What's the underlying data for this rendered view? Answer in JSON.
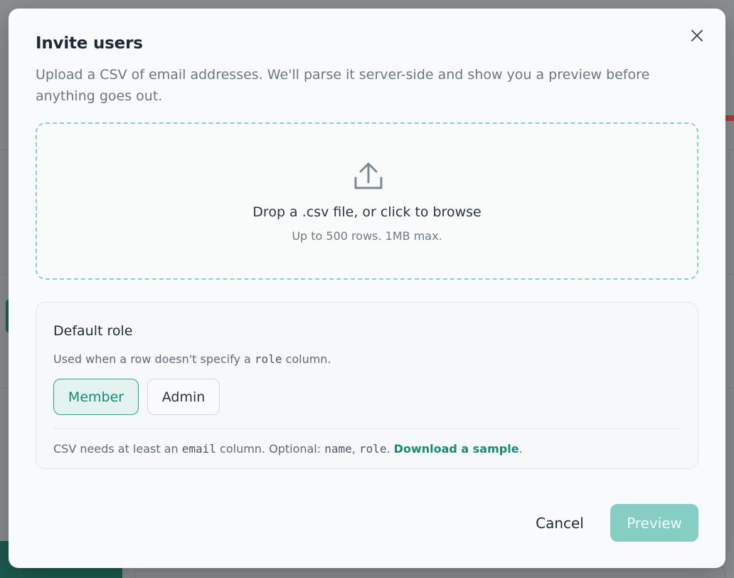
{
  "modal": {
    "title": "Invite users",
    "subtitle": "Upload a CSV of email addresses. We'll parse it server-side and show you a preview before anything goes out.",
    "close_icon": "close-icon"
  },
  "dropzone": {
    "icon": "upload-icon",
    "title": "Drop a .csv file, or click to browse",
    "hint": "Up to 500 rows. 1MB max."
  },
  "role": {
    "label": "Default role",
    "help_prefix": "Used when a row doesn't specify a",
    "help_code": "role",
    "help_suffix": "column.",
    "options": [
      {
        "label": "Member",
        "selected": true
      },
      {
        "label": "Admin",
        "selected": false
      }
    ]
  },
  "requirements": {
    "prefix": "CSV needs at least an",
    "email_code": "email",
    "middle": "column. Optional:",
    "name_code": "name",
    "comma": ",",
    "role_code": "role",
    "period": ".",
    "link": "Download a sample",
    "end": "."
  },
  "footer": {
    "cancel_label": "Cancel",
    "preview_label": "Preview"
  },
  "colors": {
    "accent": "#168a78",
    "preview_disabled": "#86cdc4",
    "dropzone_border": "#8ccfc6"
  }
}
